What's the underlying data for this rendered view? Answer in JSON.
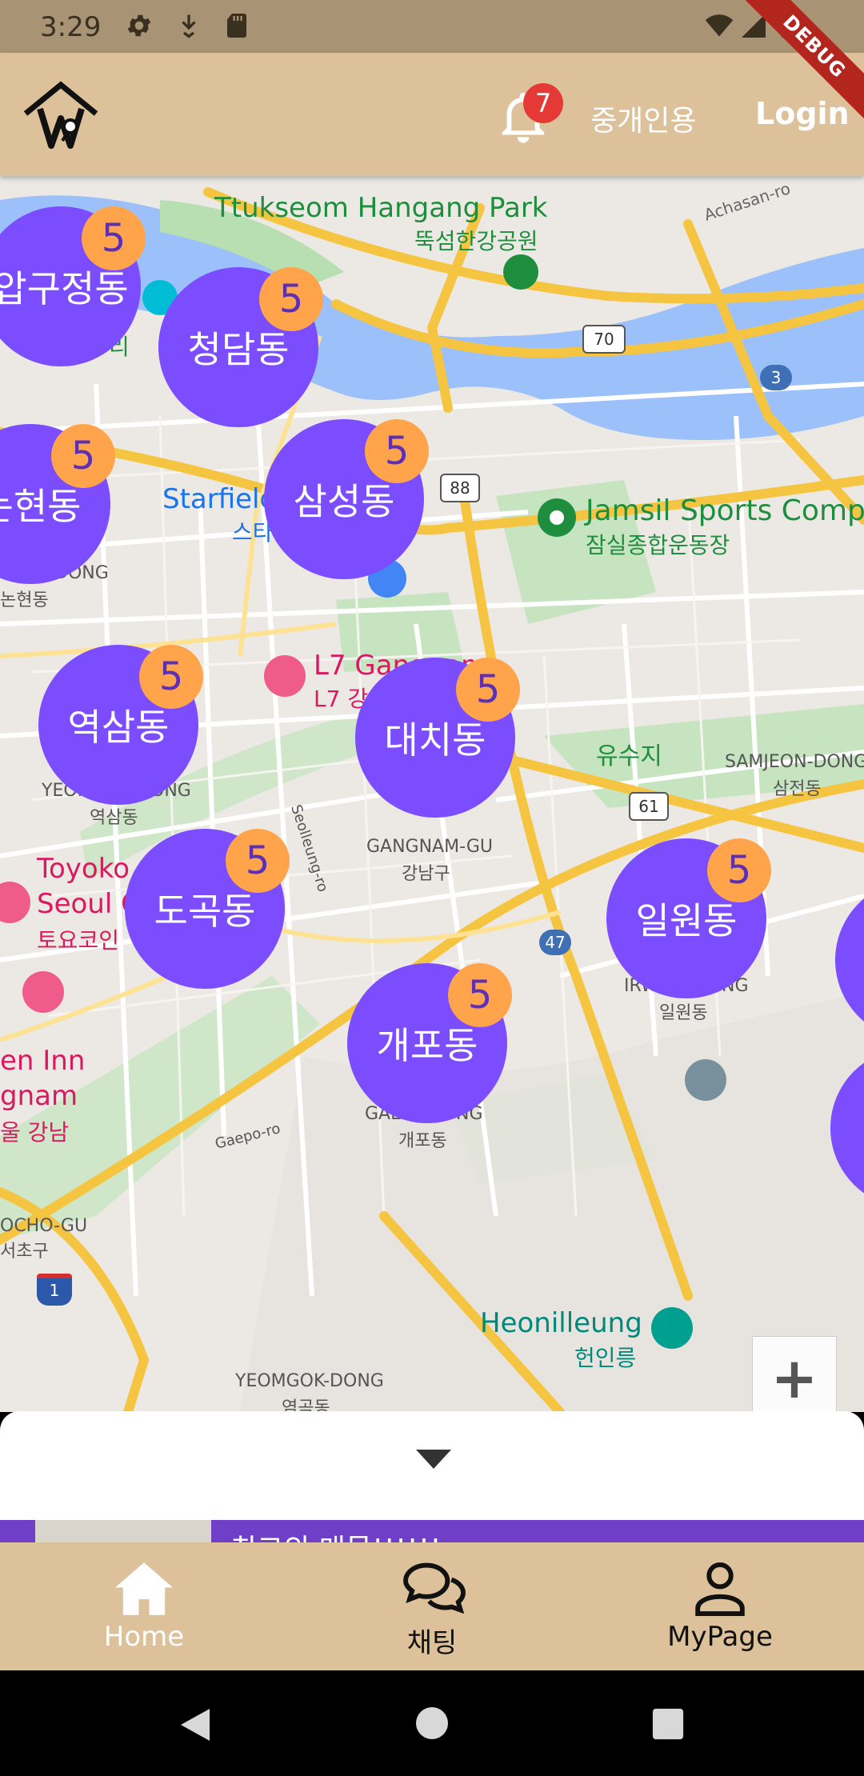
{
  "status_bar": {
    "time": "3:29",
    "debug_label": "DEBUG"
  },
  "app_bar": {
    "logo_icon": "house-logo-icon",
    "notification_count": "7",
    "agent_label": "중개인용",
    "login_label": "Login"
  },
  "map": {
    "place_labels": [
      {
        "text": "Ttukseom Hangang Park",
        "color": "#1e8e3e"
      },
      {
        "text": "뚝섬한강공원",
        "color": "#1e8e3e"
      },
      {
        "text": "Achasan-ro",
        "color": "#666666"
      },
      {
        "text": "Jamsil Sports Compl",
        "color": "#1e8e3e"
      },
      {
        "text": "잠실종합운동장",
        "color": "#1e8e3e"
      },
      {
        "text": "Starfield",
        "color": "#1a73e8"
      },
      {
        "text": "스타",
        "color": "#1a73e8"
      },
      {
        "text": "L7 Gangnam",
        "color": "#d81b60"
      },
      {
        "text": "L7 강",
        "color": "#d81b60"
      },
      {
        "text": "유수지",
        "color": "#1e8e3e"
      },
      {
        "text": "SAMJEON-DONG",
        "color": "#555555"
      },
      {
        "text": "삼전동",
        "color": "#555555"
      },
      {
        "text": "GANGNAM-GU",
        "color": "#555555"
      },
      {
        "text": "강남구",
        "color": "#555555"
      },
      {
        "text": "Seolleung-ro",
        "color": "#555555"
      },
      {
        "text": "Toyoko",
        "color": "#d81b60"
      },
      {
        "text": "Seoul G",
        "color": "#d81b60"
      },
      {
        "text": "토요코인",
        "color": "#d81b60"
      },
      {
        "text": "en Inn",
        "color": "#d81b60"
      },
      {
        "text": "gnam",
        "color": "#d81b60"
      },
      {
        "text": "울 강남",
        "color": "#d81b60"
      },
      {
        "text": "Gaepo-ro",
        "color": "#555555"
      },
      {
        "text": "OCHO-GU",
        "color": "#555555"
      },
      {
        "text": "서초구",
        "color": "#555555"
      },
      {
        "text": "Heonilleung",
        "color": "#00897b"
      },
      {
        "text": "헌인릉",
        "color": "#00897b"
      },
      {
        "text": "YEOMGOK-DONG",
        "color": "#555555"
      },
      {
        "text": "염곡동",
        "color": "#555555"
      },
      {
        "text": "IRWO",
        "color": "#555555"
      },
      {
        "text": "NG",
        "color": "#555555"
      },
      {
        "text": "일원동",
        "color": "#555555"
      },
      {
        "text": "GAE",
        "color": "#555555"
      },
      {
        "text": "NG",
        "color": "#555555"
      },
      {
        "text": "개포동",
        "color": "#555555"
      },
      {
        "text": "YEOK",
        "color": "#555555"
      },
      {
        "text": "ONG",
        "color": "#555555"
      },
      {
        "text": "역삼동",
        "color": "#555555"
      },
      {
        "text": "DONG",
        "color": "#555555"
      },
      {
        "text": "논현동",
        "color": "#555555"
      },
      {
        "text": "리",
        "color": "#1e8e3e"
      }
    ],
    "route_shields": [
      "70",
      "3",
      "88",
      "61",
      "47",
      "1"
    ],
    "clusters": [
      {
        "name": "압구정동",
        "count": "5"
      },
      {
        "name": "청담동",
        "count": "5"
      },
      {
        "name": "논현동",
        "count": "5"
      },
      {
        "name": "삼성동",
        "count": "5"
      },
      {
        "name": "역삼동",
        "count": "5"
      },
      {
        "name": "대치동",
        "count": "5"
      },
      {
        "name": "도곡동",
        "count": "5"
      },
      {
        "name": "일원동",
        "count": "5"
      },
      {
        "name": "개포동",
        "count": "5"
      }
    ],
    "zoom_in_label": "+"
  },
  "bottom_sheet": {
    "toggle_icon": "caret-down-icon",
    "peek_title": "최고의 매물!!!!!!"
  },
  "bottom_nav": {
    "items": [
      {
        "label": "Home",
        "icon": "home-icon",
        "active": true
      },
      {
        "label": "채팅",
        "icon": "chat-icon",
        "active": false
      },
      {
        "label": "MyPage",
        "icon": "person-icon",
        "active": false
      }
    ]
  },
  "colors": {
    "app_bar": "#dcc19a",
    "cluster": "#7c4dff",
    "cluster_badge": "#ffa44a",
    "notification_badge": "#e53935"
  }
}
